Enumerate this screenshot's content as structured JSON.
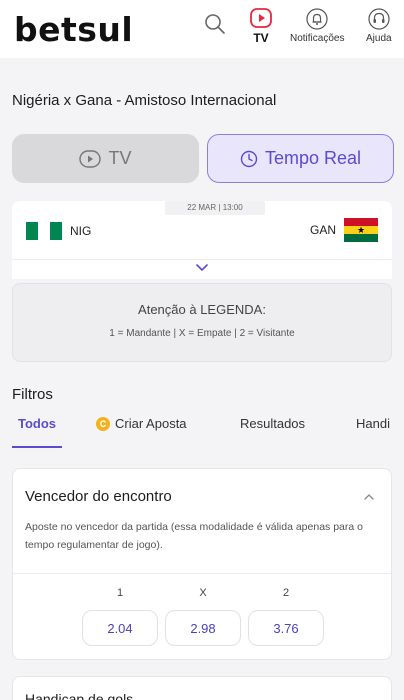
{
  "header": {
    "logo": "betsul",
    "tv_label": "TV",
    "notifications_label": "Notificações",
    "help_label": "Ajuda"
  },
  "match": {
    "title": "Nigéria x Gana - Amistoso Internacional",
    "date": "22 MAR | 13:00",
    "home_team": "NIG",
    "away_team": "GAN"
  },
  "modes": {
    "tv_label": "TV",
    "realtime_label": "Tempo Real"
  },
  "legend": {
    "title": "Atenção à LEGENDA:",
    "text": "1 = Mandante | X = Empate | 2 = Visitante"
  },
  "filters": {
    "label": "Filtros",
    "tabs": [
      "Todos",
      "Criar Aposta",
      "Resultados",
      "Handi"
    ]
  },
  "market": {
    "title": "Vencedor do encontro",
    "description": "Aposte no vencedor da partida (essa modalidade é válida apenas para o tempo regulamentar de jogo).",
    "odds": [
      {
        "label": "1",
        "value": "2.04"
      },
      {
        "label": "X",
        "value": "2.98"
      },
      {
        "label": "2",
        "value": "3.76"
      }
    ]
  },
  "next_market": {
    "title": "Handicap de gols"
  },
  "colors": {
    "accent": "#5b4bd3",
    "tv_red": "#e8283c",
    "nigeria_green": "#008751",
    "ghana_red": "#ce1126",
    "ghana_gold": "#fcd116",
    "ghana_green": "#006b3f"
  }
}
